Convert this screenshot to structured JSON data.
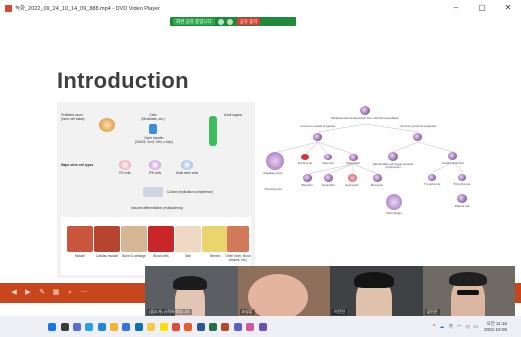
{
  "window": {
    "title": "녹화_2022_09_24_10_14_09_888.mp4 - DVD Video Player",
    "minimize_glyph": "–",
    "maximize_glyph": "▢",
    "close_glyph": "✕"
  },
  "recording_bar": {
    "status_label": "화면 공유 중입니다",
    "stop_label": "공유 중지"
  },
  "slide": {
    "title": "Introduction",
    "left_figure": {
      "top_left": "Fertilized ovum\n(inner cell mass)",
      "top_mid": "Cells\n(fibroblasts, etc.)",
      "top_right": "Adult organs",
      "gene_transfer": "Gene transfer\n(Oct3/4, Sox2, Klf4, c-Myc)",
      "major_types": "Major stem cell types",
      "es": "ES cells",
      "ips": "iPS cells",
      "adult": "Adult stem cells",
      "culture": "Culture (replication competence)",
      "induced": "Induced differentiation (multipotency)",
      "tissues": [
        "Muscle",
        "Cardiac muscle",
        "Bone & cartilage",
        "Blood cells",
        "Skin",
        "Nerves",
        "Other (liver, blood vessels, etc.)"
      ]
    },
    "right_figure": {
      "root": "Multipotential hematopoietic stem cell (Hemocytoblast)",
      "myeloid": "Common myeloid progenitor",
      "lymphoid": "Common lymphoid progenitor",
      "myeloid_children": [
        "Erythrocyte",
        "Mast cell",
        "Myeloblast"
      ],
      "megakaryocyte": "Megakaryocyte",
      "thrombocytes": "Thrombocytes",
      "granulocytes": [
        "Basophil",
        "Neutrophil",
        "Eosinophil",
        "Monocyte"
      ],
      "nk": "Natural killer cell (Large granular lymphocyte)",
      "small_lymph": "Small lymphocyte",
      "t_cell": "T lymphocyte",
      "b_cell": "B lymphocyte",
      "plasma": "Plasma cell",
      "macrophage": "Macrophage"
    }
  },
  "participants": [
    {
      "name": "(음소거) 시작하겠습니다",
      "color": "#5b5f63"
    },
    {
      "name": "조성훈",
      "color": "#8d6f5c"
    },
    {
      "name": "이건진",
      "color": "#3f4145"
    },
    {
      "name": "김민준",
      "color": "#6f6a64"
    }
  ],
  "taskbar": {
    "start": "start-icon",
    "icons": [
      "search-icon",
      "chat-icon",
      "widgets-icon",
      "edge-icon",
      "explorer-icon",
      "store-icon",
      "mail-icon",
      "folder-icon",
      "kakaotalk-icon",
      "chrome-icon",
      "office-icon",
      "word-icon",
      "excel-icon",
      "powerpoint-icon",
      "teams-icon",
      "photos-icon",
      "player-icon"
    ],
    "time": "오전 11:16",
    "date": "2022-10-05",
    "lang": "가"
  },
  "colors": {
    "accent": "#c8461c",
    "recording_green": "#1e8a3a",
    "stop_red": "#e23b3b"
  }
}
